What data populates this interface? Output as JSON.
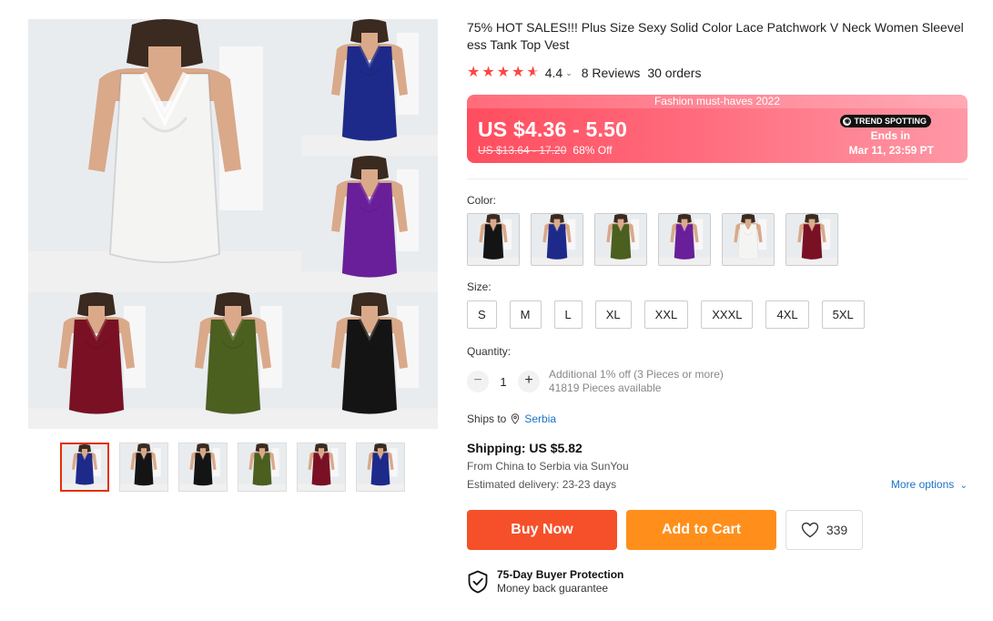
{
  "product": {
    "title": "75% HOT SALES!!! Plus Size Sexy Solid Color Lace Patchwork V Neck Women Sleeveless Tank Top Vest",
    "rating_value": "4.4",
    "rating_stars": 4.4,
    "reviews": "8 Reviews",
    "orders": "30 orders"
  },
  "gallery": {
    "tiles": [
      {
        "color": "white",
        "hex": "#f4f4f2"
      },
      {
        "color": "navy",
        "hex": "#1e2a8a"
      },
      {
        "color": "purple",
        "hex": "#6a1f9a"
      },
      {
        "color": "wine",
        "hex": "#7a1024"
      },
      {
        "color": "olive",
        "hex": "#4b5f1f"
      },
      {
        "color": "black",
        "hex": "#141414"
      }
    ],
    "thumbnails": [
      {
        "color": "collage",
        "hex": "#1e2a8a"
      },
      {
        "color": "black",
        "hex": "#141414"
      },
      {
        "color": "black-back",
        "hex": "#141414"
      },
      {
        "color": "olive",
        "hex": "#4b5f1f"
      },
      {
        "color": "wine",
        "hex": "#7a1024"
      },
      {
        "color": "navy",
        "hex": "#1e2a8a"
      }
    ]
  },
  "price": {
    "banner_headline": "Fashion must-haves 2022",
    "current": "US $4.36 - 5.50",
    "original": "US $13.64 - 17.20",
    "discount": "68% Off",
    "badge": "TREND SPOTTING",
    "ends_label": "Ends in",
    "ends_time": "Mar 11, 23:59 PT"
  },
  "color": {
    "label": "Color:",
    "options": [
      {
        "name": "black",
        "hex": "#141414"
      },
      {
        "name": "navy",
        "hex": "#1e2a8a"
      },
      {
        "name": "olive",
        "hex": "#4b5f1f"
      },
      {
        "name": "purple",
        "hex": "#6a1f9a"
      },
      {
        "name": "white",
        "hex": "#f4f4f2"
      },
      {
        "name": "wine",
        "hex": "#7a1024"
      }
    ]
  },
  "size": {
    "label": "Size:",
    "options": [
      "S",
      "M",
      "L",
      "XL",
      "XXL",
      "XXXL",
      "4XL",
      "5XL"
    ]
  },
  "quantity": {
    "label": "Quantity:",
    "minus": "−",
    "value": "1",
    "plus": "+",
    "note_discount": "Additional 1% off (3 Pieces or more)",
    "note_available": "41819 Pieces available"
  },
  "shipping": {
    "ships_to_label": "Ships to",
    "ships_to_location": "Serbia",
    "title": "Shipping: US $5.82",
    "route": "From China to Serbia via SunYou",
    "delivery": "Estimated delivery: 23-23 days",
    "more_options": "More options"
  },
  "actions": {
    "buy_now": "Buy Now",
    "add_to_cart": "Add to Cart",
    "wishlist_count": "339"
  },
  "protection": {
    "title": "75-Day Buyer Protection",
    "subtitle": "Money back guarantee"
  },
  "colors": {
    "accent_red": "#f5502a",
    "accent_orange": "#ff8f1a",
    "link_blue": "#1a73c8",
    "star_red": "#ff4444"
  }
}
